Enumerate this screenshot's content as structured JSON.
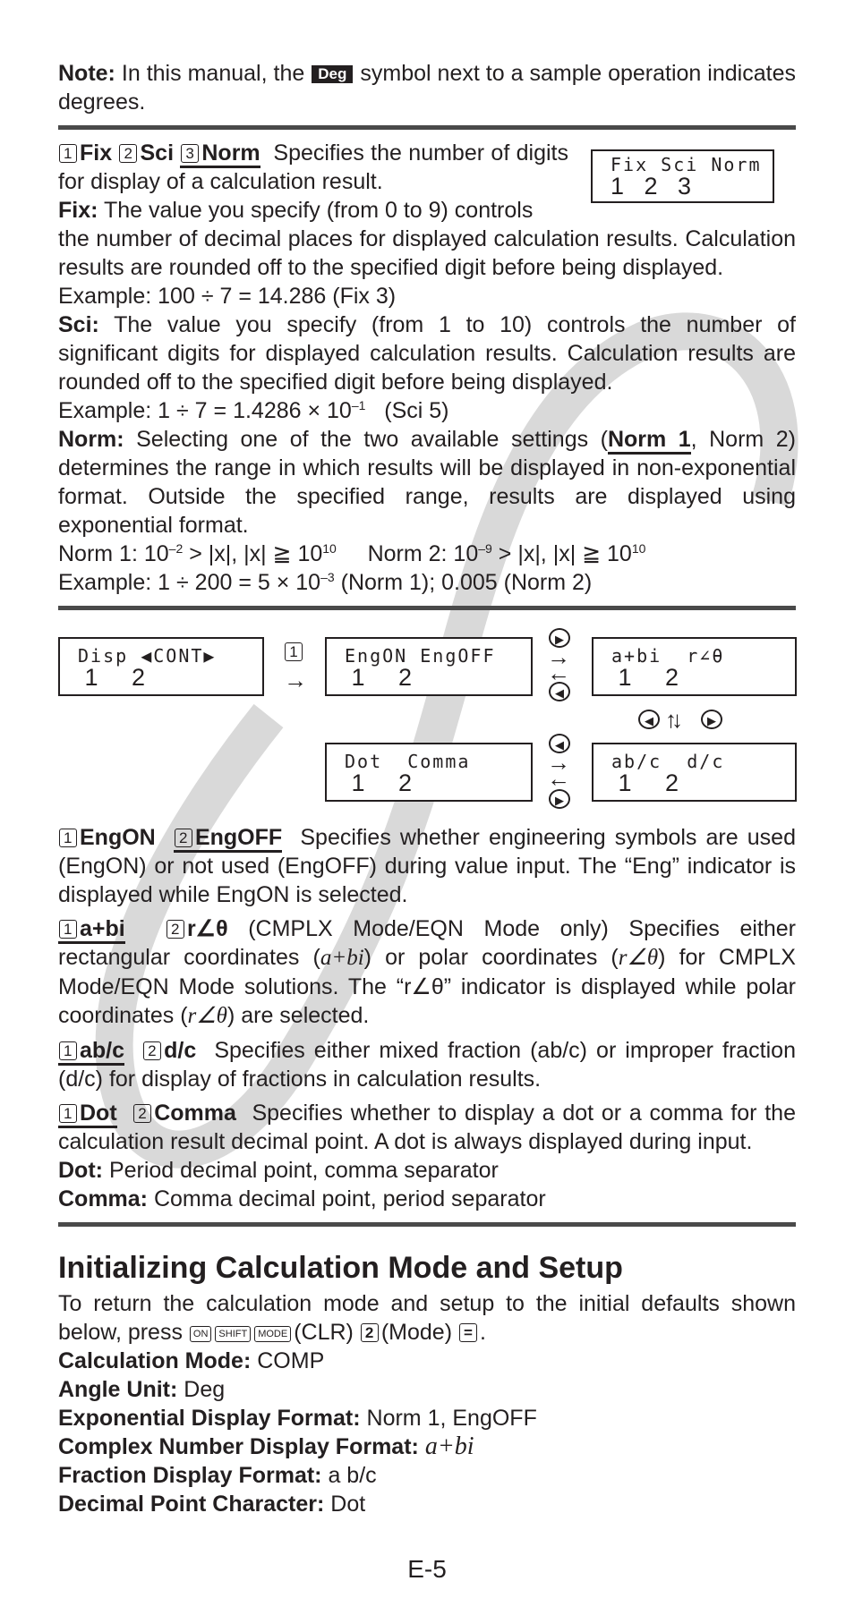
{
  "note": {
    "label": "Note:",
    "text_before": "In this manual, the",
    "badge": "Deg",
    "text_after": "symbol next to a sample operation indicates degrees."
  },
  "fsn": {
    "options": [
      {
        "key": "1",
        "label": "Fix"
      },
      {
        "key": "2",
        "label": "Sci"
      },
      {
        "key": "3",
        "label": "Norm"
      }
    ],
    "intro": "Specifies the number of digits for display of a calculation result.",
    "lcd_top": "Fix Sci Norm",
    "lcd_bottom": "1   2   3",
    "fix_label": "Fix:",
    "fix_text_a": "The value you specify (from 0 to 9) controls",
    "fix_text_b": "the number of decimal places for displayed calculation results. Calculation results are rounded off to the specified digit before being displayed.",
    "fix_example": "Example: 100 ÷ 7 = 14.286   (Fix 3)",
    "sci_label": "Sci:",
    "sci_text": "The value you specify (from 1 to 10) controls the number of significant digits for displayed calculation results. Calculation results are rounded off to the specified digit before being displayed.",
    "sci_example_a": "Example: 1 ÷ 7 = 1.4286 × 10",
    "sci_example_exp": "–1",
    "sci_example_b": "   (Sci 5)",
    "norm_label": "Norm:",
    "norm_text_a": "Selecting one of the two available settings (",
    "norm_default": "Norm 1",
    "norm_text_b": ", Norm 2) determines the range in which results will be displayed in non-exponential format. Outside the specified range, results are displayed using exponential format.",
    "norm_ranges": {
      "n1_prefix": "Norm 1: 10",
      "n1_exp": "–2",
      "n1_mid": " > |x|, |x| ≧ 10",
      "n1_exp2": "10",
      "n2_prefix": "Norm 2: 10",
      "n2_exp": "–9",
      "n2_mid": " > |x|, |x| ≧ 10",
      "n2_exp2": "10"
    },
    "norm_example_a": "Example: 1 ÷ 200 = 5 × 10",
    "norm_example_exp": "–3",
    "norm_example_b": " (Norm 1); 0.005 (Norm 2)"
  },
  "diagram": {
    "disp": {
      "top": "Disp ◀CONT▶",
      "bottom": " 1     2"
    },
    "key_1": "1",
    "eng": {
      "top": "EngON EngOFF",
      "bottom": " 1     2"
    },
    "cplx": {
      "top": "a+bi  r∠θ",
      "bottom": " 1     2"
    },
    "dot": {
      "top": "Dot  Comma",
      "bottom": " 1     2"
    },
    "frac": {
      "top": "ab/c  d/c",
      "bottom": " 1     2"
    },
    "right_glyph": "▶",
    "left_glyph": "◀",
    "arrow_right": "→",
    "arrow_left": "←",
    "arrow_updown": "↑↓"
  },
  "eng": {
    "k1": "1",
    "l1": "EngON",
    "k2": "2",
    "l2": "EngOFF",
    "text": "Specifies whether engineering symbols are used (EngON) or not used (EngOFF) during value input. The “Eng” indicator is displayed while EngON is selected."
  },
  "cplx": {
    "k1": "1",
    "l1": "a+bi",
    "k2": "2",
    "l2": "r∠θ",
    "text_a": "(CMPLX Mode/EQN Mode only)  Specifies either rectangular coordinates (",
    "ab": "a+bi",
    "text_b": ") or polar coordinates (",
    "rt": "r∠θ",
    "text_c": ") for CMPLX Mode/EQN Mode solutions. The “r∠θ” indicator is displayed while polar coordinates (",
    "rt2": "r∠θ",
    "text_d": ") are selected."
  },
  "frac": {
    "k1": "1",
    "l1": "ab/c",
    "k2": "2",
    "l2": "d/c",
    "text": "Specifies either mixed fraction (ab/c) or improper fraction (d/c) for display of fractions in calculation results."
  },
  "dot": {
    "k1": "1",
    "l1": "Dot",
    "k2": "2",
    "l2": "Comma",
    "text": "Specifies whether to display a dot or a comma for the calculation result decimal point. A dot is always displayed during input.",
    "dot_label": "Dot:",
    "dot_text": "Period decimal point, comma separator",
    "comma_label": "Comma:",
    "comma_text": "Comma decimal point, period separator"
  },
  "init": {
    "heading": "Initializing Calculation Mode and Setup",
    "text_a": "To return the calculation mode and setup to the initial defaults shown below, press",
    "keys": {
      "on": "ON",
      "shift": "SHIFT",
      "mode": "MODE",
      "two": "2",
      "eq": "="
    },
    "clr": "(CLR)",
    "mode": "(Mode)",
    "end": ".",
    "defaults": [
      {
        "label": "Calculation Mode:",
        "value": "COMP"
      },
      {
        "label": "Angle Unit:",
        "value": "Deg"
      },
      {
        "label": "Exponential Display Format:",
        "value": "Norm 1, EngOFF"
      },
      {
        "label": "Complex Number Display Format:",
        "value": "a+bi"
      },
      {
        "label": "Fraction Display Format:",
        "value": "a b/c"
      },
      {
        "label": "Decimal Point Character:",
        "value": "Dot"
      }
    ]
  },
  "page_number": "E-5"
}
